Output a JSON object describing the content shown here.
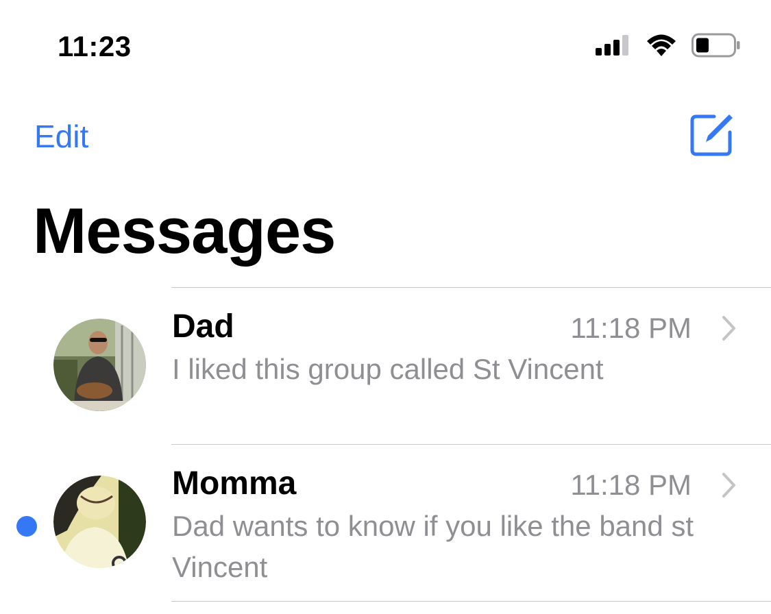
{
  "status_bar": {
    "time": "11:23",
    "signal_icon": "cellular-signal-icon",
    "wifi_icon": "wifi-icon",
    "battery_icon": "battery-low-icon"
  },
  "nav": {
    "edit_label": "Edit",
    "compose_icon": "compose-icon",
    "accent_color": "#3478f6"
  },
  "title": "Messages",
  "conversations": [
    {
      "sender": "Dad",
      "time": "11:18 PM",
      "preview": "I liked this group called St Vincent",
      "unread": false,
      "avatar_icon": "contact-photo"
    },
    {
      "sender": "Momma",
      "time": "11:18 PM",
      "preview": "Dad wants to know if you like the band st Vincent",
      "unread": true,
      "avatar_icon": "contact-photo"
    }
  ]
}
